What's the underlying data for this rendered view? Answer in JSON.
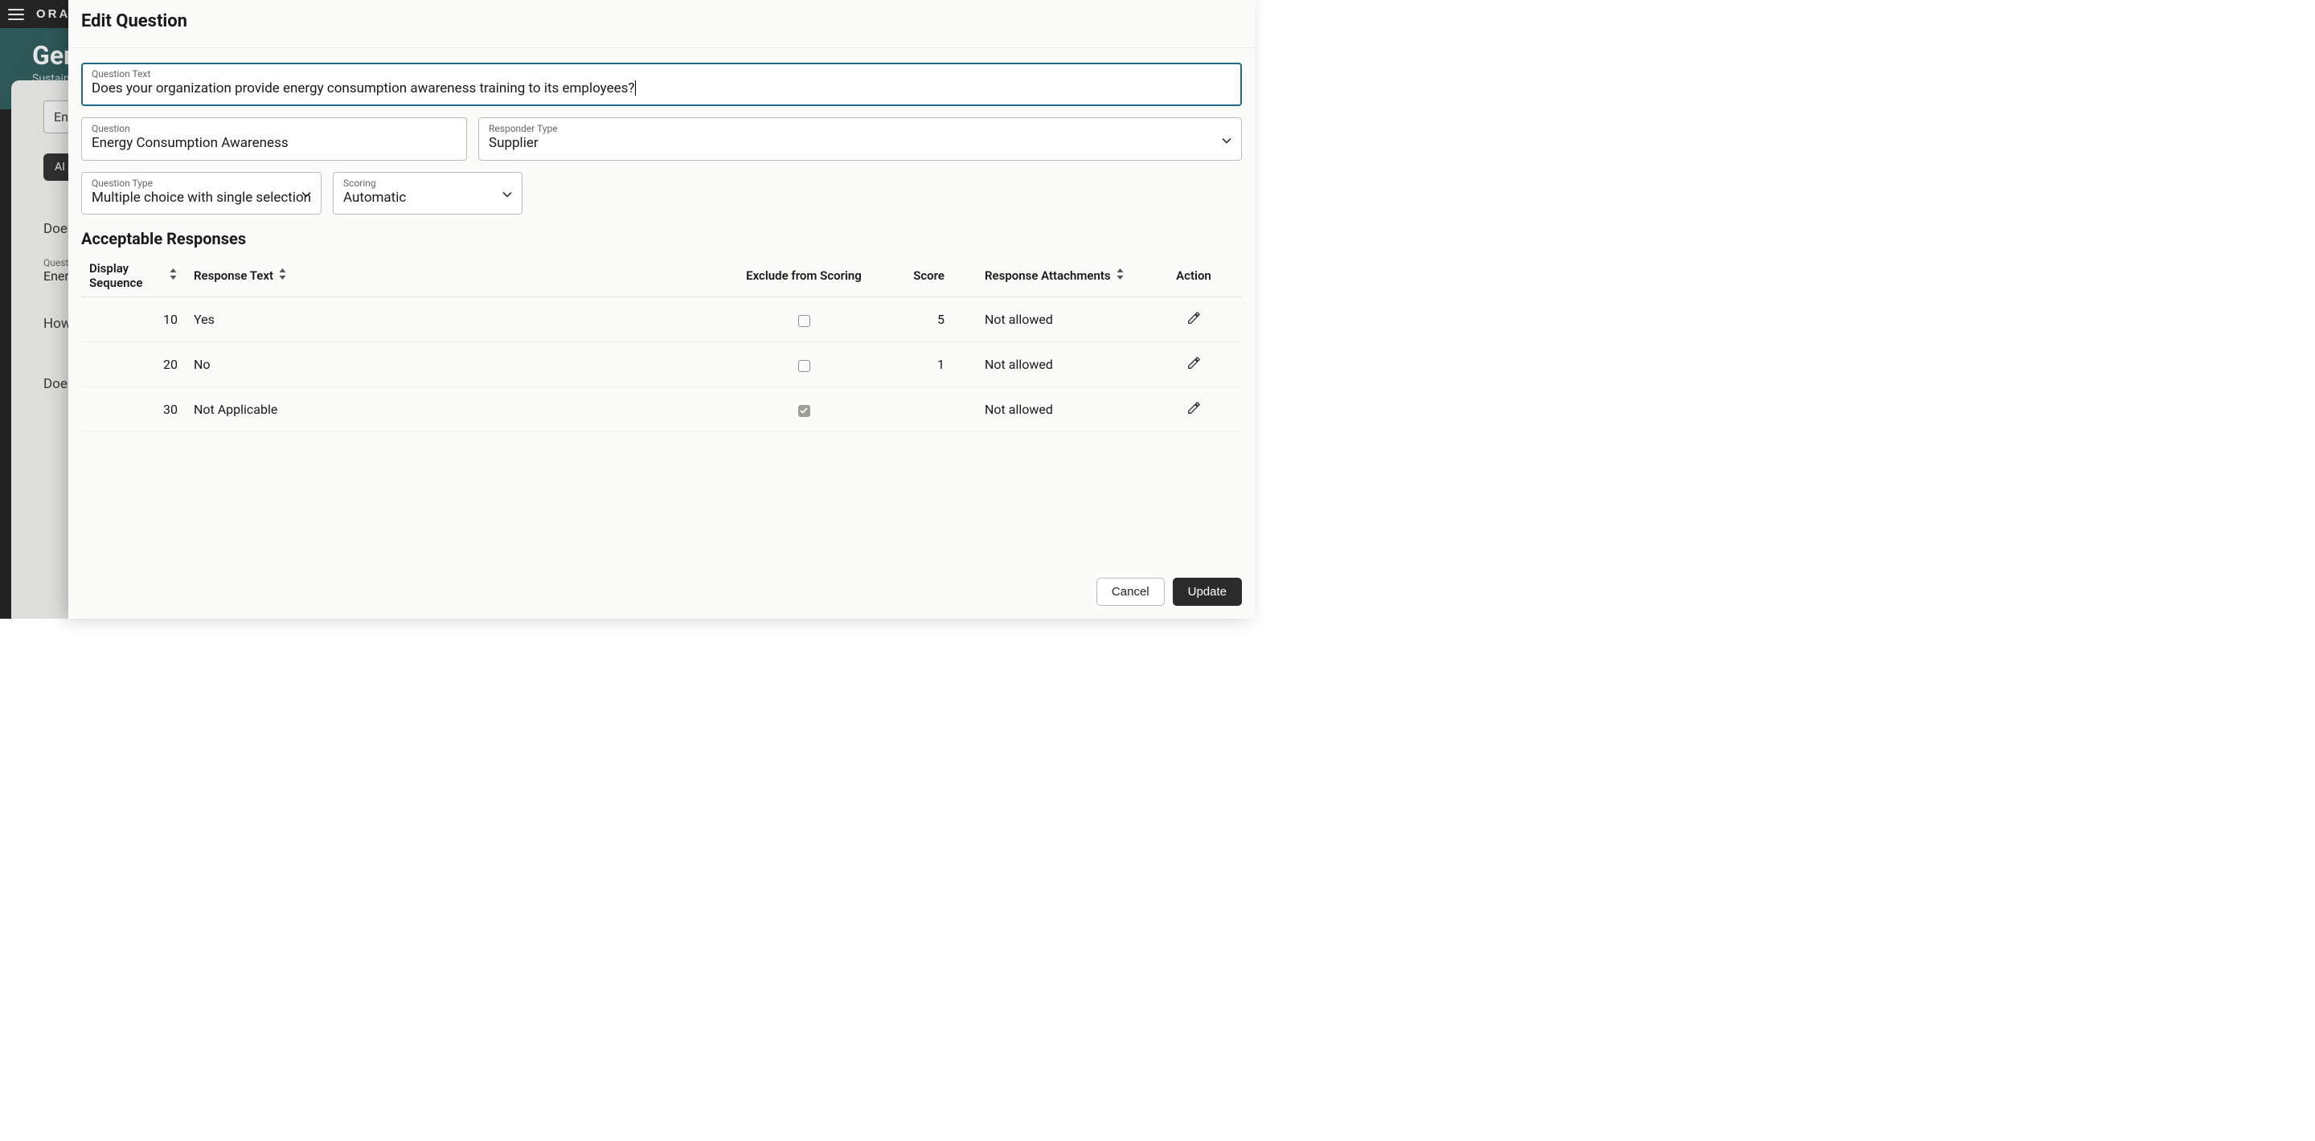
{
  "backdrop": {
    "oracle": "ORACL",
    "title": "Gene",
    "subtitle": "Sustainabili",
    "chip": "Energy,",
    "ai_btn": "AI Assist",
    "q1": "Does your",
    "q_label": "Question",
    "q_val": "Energy C",
    "q2": "How does",
    "q3": "Does your"
  },
  "modal": {
    "title": "Edit Question",
    "question_text": {
      "label": "Question Text",
      "value": "Does your organization provide energy consumption awareness training to its employees?"
    },
    "question": {
      "label": "Question",
      "value": "Energy Consumption Awareness"
    },
    "responder_type": {
      "label": "Responder Type",
      "value": "Supplier"
    },
    "question_type": {
      "label": "Question Type",
      "value": "Multiple choice with single selection"
    },
    "scoring": {
      "label": "Scoring",
      "value": "Automatic"
    },
    "responses_title": "Acceptable Responses",
    "headers": {
      "seq": "Display Sequence",
      "text": "Response Text",
      "excl": "Exclude from Scoring",
      "score": "Score",
      "attach": "Response Attachments",
      "action": "Action"
    },
    "rows": [
      {
        "seq": "10",
        "text": "Yes",
        "excl": false,
        "score": "5",
        "attach": "Not allowed"
      },
      {
        "seq": "20",
        "text": "No",
        "excl": false,
        "score": "1",
        "attach": "Not allowed"
      },
      {
        "seq": "30",
        "text": "Not Applicable",
        "excl": true,
        "score": "",
        "attach": "Not allowed"
      }
    ],
    "buttons": {
      "cancel": "Cancel",
      "update": "Update"
    }
  }
}
